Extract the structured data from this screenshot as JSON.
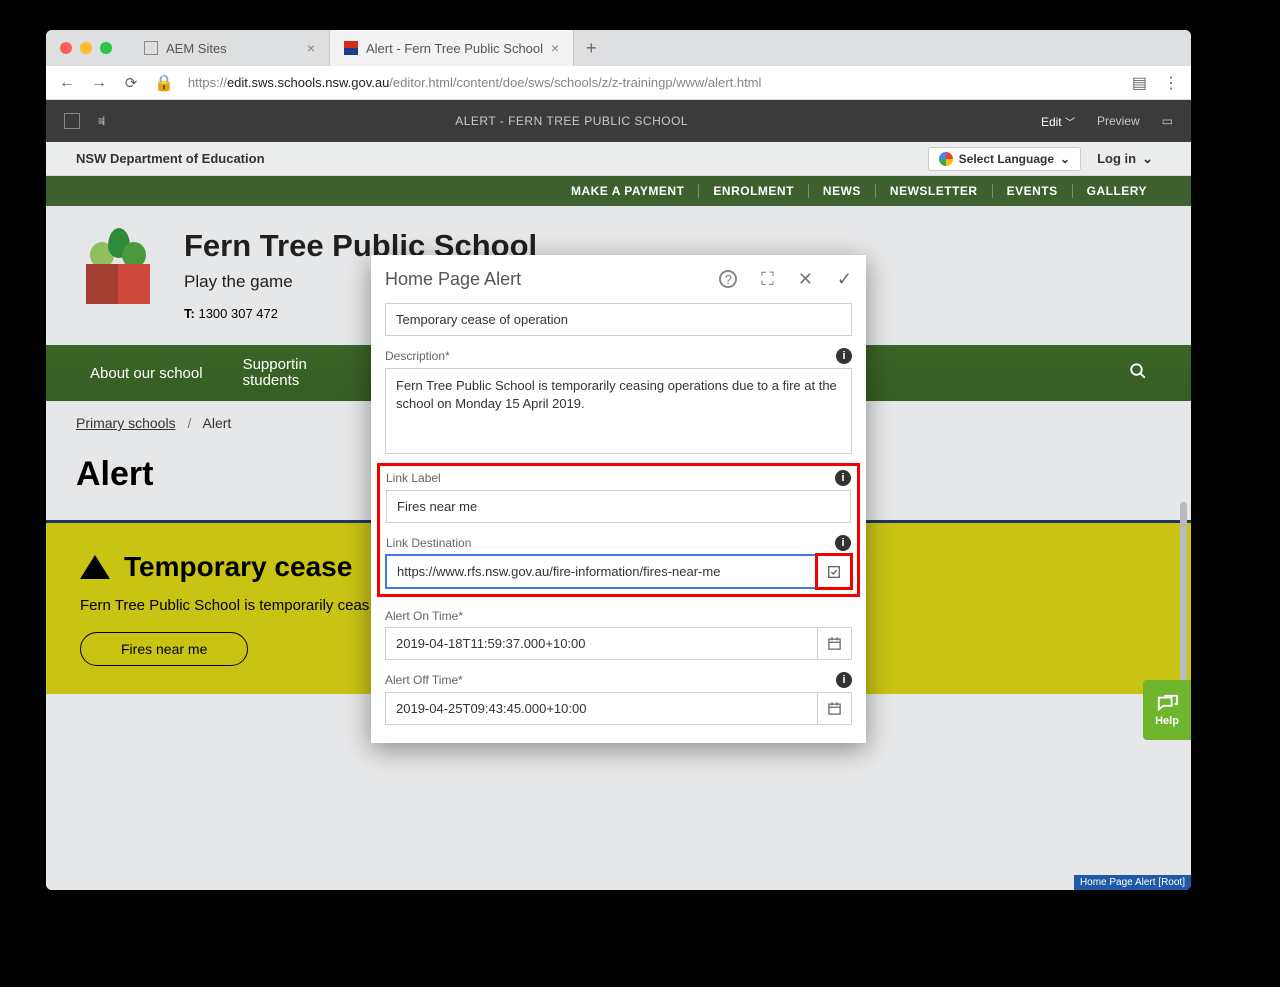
{
  "browser": {
    "tabs": [
      {
        "label": "AEM Sites",
        "active": false
      },
      {
        "label": "Alert - Fern Tree Public School",
        "active": true
      }
    ],
    "url_prefix": "https://",
    "url_host": "edit.sws.schools.nsw.gov.au",
    "url_path": "/editor.html/content/doe/sws/schools/z/z-trainingp/www/alert.html"
  },
  "aem": {
    "title": "ALERT - FERN TREE PUBLIC SCHOOL",
    "mode": "Edit",
    "preview": "Preview"
  },
  "dept": {
    "label": "NSW Department of Education",
    "lang": "Select Language",
    "login": "Log in"
  },
  "util_nav": [
    "MAKE A PAYMENT",
    "ENROLMENT",
    "NEWS",
    "NEWSLETTER",
    "EVENTS",
    "GALLERY"
  ],
  "school": {
    "name": "Fern Tree Public School",
    "motto": "Play the game",
    "phone_label": "T:",
    "phone": "1300 307 472"
  },
  "main_nav": {
    "about": "About our school",
    "support_line1": "Supportin",
    "support_line2": "students",
    "search_aria": "search"
  },
  "crumbs": {
    "root": "Primary schools",
    "sep": "/",
    "current": "Alert"
  },
  "page": {
    "h1": "Alert"
  },
  "alert_box": {
    "title": "Temporary cease",
    "desc": "Fern Tree Public School is temporarily ceas",
    "link": "Fires near me"
  },
  "root_tag": "Home Page Alert [Root]",
  "help": "Help",
  "dialog": {
    "title": "Home Page Alert",
    "title_value": "Temporary cease of operation",
    "desc_label": "Description*",
    "desc_value": "Fern Tree Public School is temporarily ceasing operations due to a fire at the school on Monday 15 April 2019.",
    "link_label_label": "Link Label",
    "link_label_value": "Fires near me",
    "link_dest_label": "Link Destination",
    "link_dest_value": "https://www.rfs.nsw.gov.au/fire-information/fires-near-me",
    "on_label": "Alert On Time*",
    "on_value": "2019-04-18T11:59:37.000+10:00",
    "off_label": "Alert Off Time*",
    "off_value": "2019-04-25T09:43:45.000+10:00"
  }
}
